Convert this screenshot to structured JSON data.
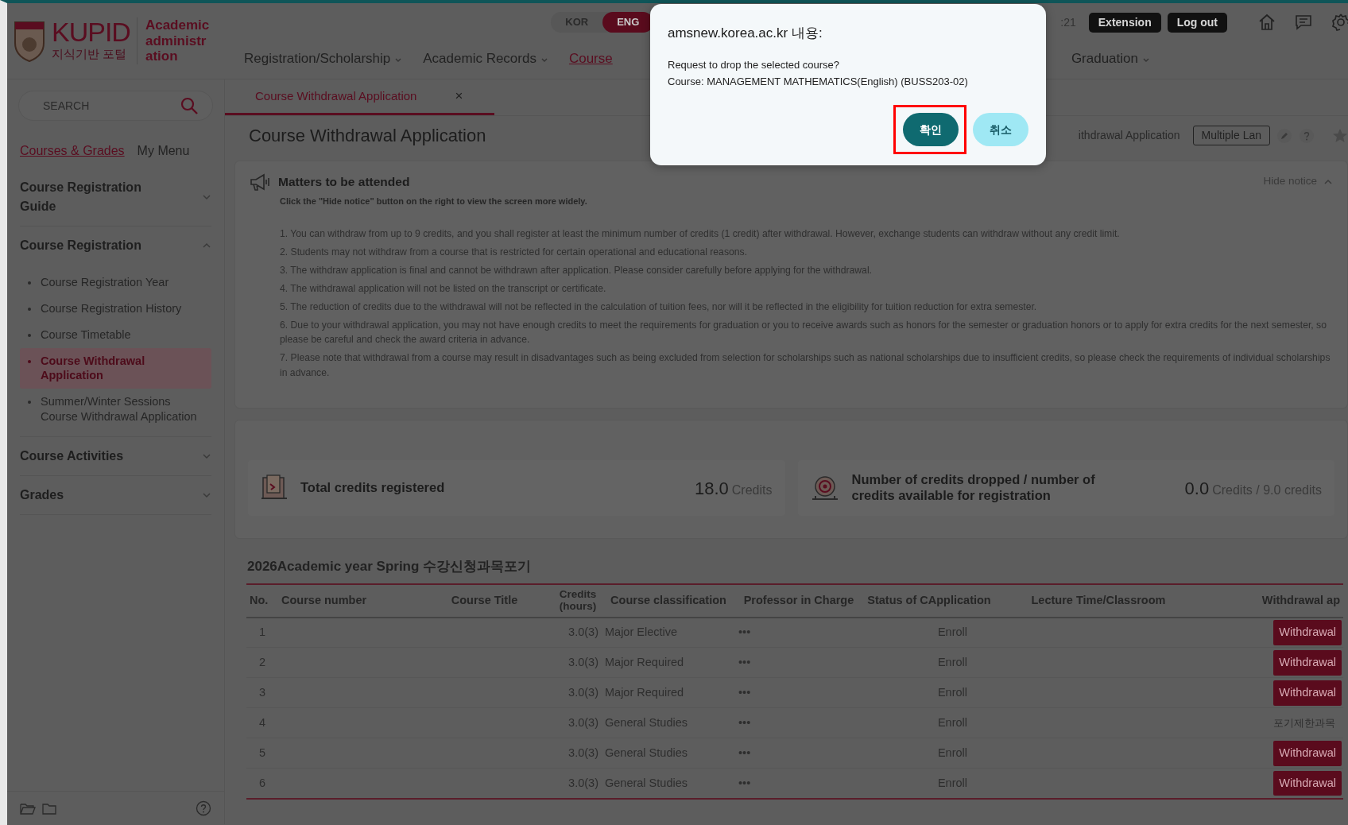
{
  "header": {
    "logo_text": "KUPID",
    "logo_subtitle": "지식기반 포털",
    "site_label": "Academic administration",
    "languages": [
      {
        "label": "KOR",
        "selected": false
      },
      {
        "label": "ENG",
        "selected": true
      }
    ],
    "nav": [
      {
        "label": "Registration/Scholarship",
        "selected": false,
        "dropdown": true
      },
      {
        "label": "Academic Records",
        "selected": false,
        "dropdown": true
      },
      {
        "label": "Course",
        "selected": true,
        "dropdown": false
      },
      {
        "label": "Graduation",
        "selected": false,
        "dropdown": true
      }
    ],
    "session_timer": ":21",
    "buttons": [
      "Extension",
      "Log out"
    ]
  },
  "sidebar": {
    "search": {
      "placeholder": "SEARCH"
    },
    "tabs": [
      {
        "label": "Courses & Grades",
        "selected": true
      },
      {
        "label": "My Menu",
        "selected": false
      }
    ],
    "menu": [
      {
        "label": "Course Registration Guide",
        "expanded": false
      },
      {
        "label": "Course Registration",
        "expanded": true,
        "children": [
          {
            "label": "Course Registration Year",
            "selected": false
          },
          {
            "label": "Course Registration History",
            "selected": false
          },
          {
            "label": "Course Timetable",
            "selected": false
          },
          {
            "label": "Course Withdrawal Application",
            "selected": true
          },
          {
            "label": "Summer/Winter Sessions Course Withdrawal Application",
            "selected": false
          }
        ]
      },
      {
        "label": "Course Activities",
        "expanded": false
      },
      {
        "label": "Grades",
        "expanded": false
      }
    ]
  },
  "content": {
    "tab": {
      "label": "Course Withdrawal Application",
      "selected": true,
      "close": "×"
    },
    "page_title": "Course Withdrawal Application",
    "breadcrumb": "ithdrawal Application",
    "language_button": "Multiple Lan",
    "notice": {
      "title": "Matters to be attended",
      "hint": "Click the \"Hide notice\" button on the right to view the screen more widely.",
      "toggle": "Hide notice",
      "items": [
        "1. You can withdraw from up to 9 credits, and you shall register at least the minimum number of credits (1 credit) after withdrawal. However, exchange students can withdraw without any credit limit.",
        "2. Students may not withdraw from a course that is restricted for certain operational and educational reasons.",
        "3. The withdraw application is final and cannot be withdrawn after application. Please consider carefully before applying for the withdrawal.",
        "4. The withdrawal application will not be listed on the transcript or certificate.",
        "5. The reduction of credits due to the withdrawal will not be reflected in the calculation of tuition fees, nor will it be reflected in the eligibility for tuition reduction for extra semester.",
        "6. Due to your withdrawal application, you may not have enough credits to meet the requirements for graduation or you to receive awards such as honors for the semester or graduation honors or to apply for extra credits for the next semester, so please be careful and check the award criteria in advance.",
        "7. Please note that withdrawal from a course may result in disadvantages such as being excluded from selection for scholarships such as national scholarships due to insufficient credits, so please check the requirements of individual scholarships in advance."
      ]
    },
    "stats": [
      {
        "kind": "document",
        "label": "Total credits registered",
        "value": "18.0",
        "unit": "Credits"
      },
      {
        "kind": "target",
        "label": "Number of credits dropped / number of credits available for registration",
        "value": "0.0",
        "unit": "Credits / 9.0 credits"
      }
    ],
    "table": {
      "title": "2026Academic year Spring 수강신청과목포기",
      "columns": [
        "No.",
        "Course number",
        "Course Title",
        "Credits (hours)",
        "Course classification",
        "Professor in Charge",
        "Status of CApplication",
        "Lecture Time/Classroom",
        "Withdrawal ap"
      ],
      "rows": [
        {
          "no": "1",
          "credits": "3.0(3)",
          "classification": "Major Elective",
          "professor": "•••",
          "status": "Enroll",
          "withdrawal": {
            "kind": "button",
            "label": "Withdrawal"
          }
        },
        {
          "no": "2",
          "credits": "3.0(3)",
          "classification": "Major Required",
          "professor": "•••",
          "status": "Enroll",
          "withdrawal": {
            "kind": "button",
            "label": "Withdrawal"
          }
        },
        {
          "no": "3",
          "credits": "3.0(3)",
          "classification": "Major Required",
          "professor": "•••",
          "status": "Enroll",
          "withdrawal": {
            "kind": "button",
            "label": "Withdrawal"
          }
        },
        {
          "no": "4",
          "credits": "3.0(3)",
          "classification": "General Studies",
          "professor": "•••",
          "status": "Enroll",
          "withdrawal": {
            "kind": "text",
            "label": "포기제한과목"
          }
        },
        {
          "no": "5",
          "credits": "3.0(3)",
          "classification": "General Studies",
          "professor": "•••",
          "status": "Enroll",
          "withdrawal": {
            "kind": "button",
            "label": "Withdrawal"
          }
        },
        {
          "no": "6",
          "credits": "3.0(3)",
          "classification": "General Studies",
          "professor": "•••",
          "status": "Enroll",
          "withdrawal": {
            "kind": "button",
            "label": "Withdrawal"
          }
        }
      ]
    }
  },
  "dialog": {
    "title": "amsnew.korea.ac.kr 내용:",
    "message": [
      "Request to drop the selected course?",
      "Course: MANAGEMENT MATHEMATICS(English) (BUSS203-02)"
    ],
    "buttons": [
      {
        "label": "확인",
        "kind": "primary",
        "highlighted": true
      },
      {
        "label": "취소",
        "kind": "secondary",
        "highlighted": false
      }
    ]
  }
}
